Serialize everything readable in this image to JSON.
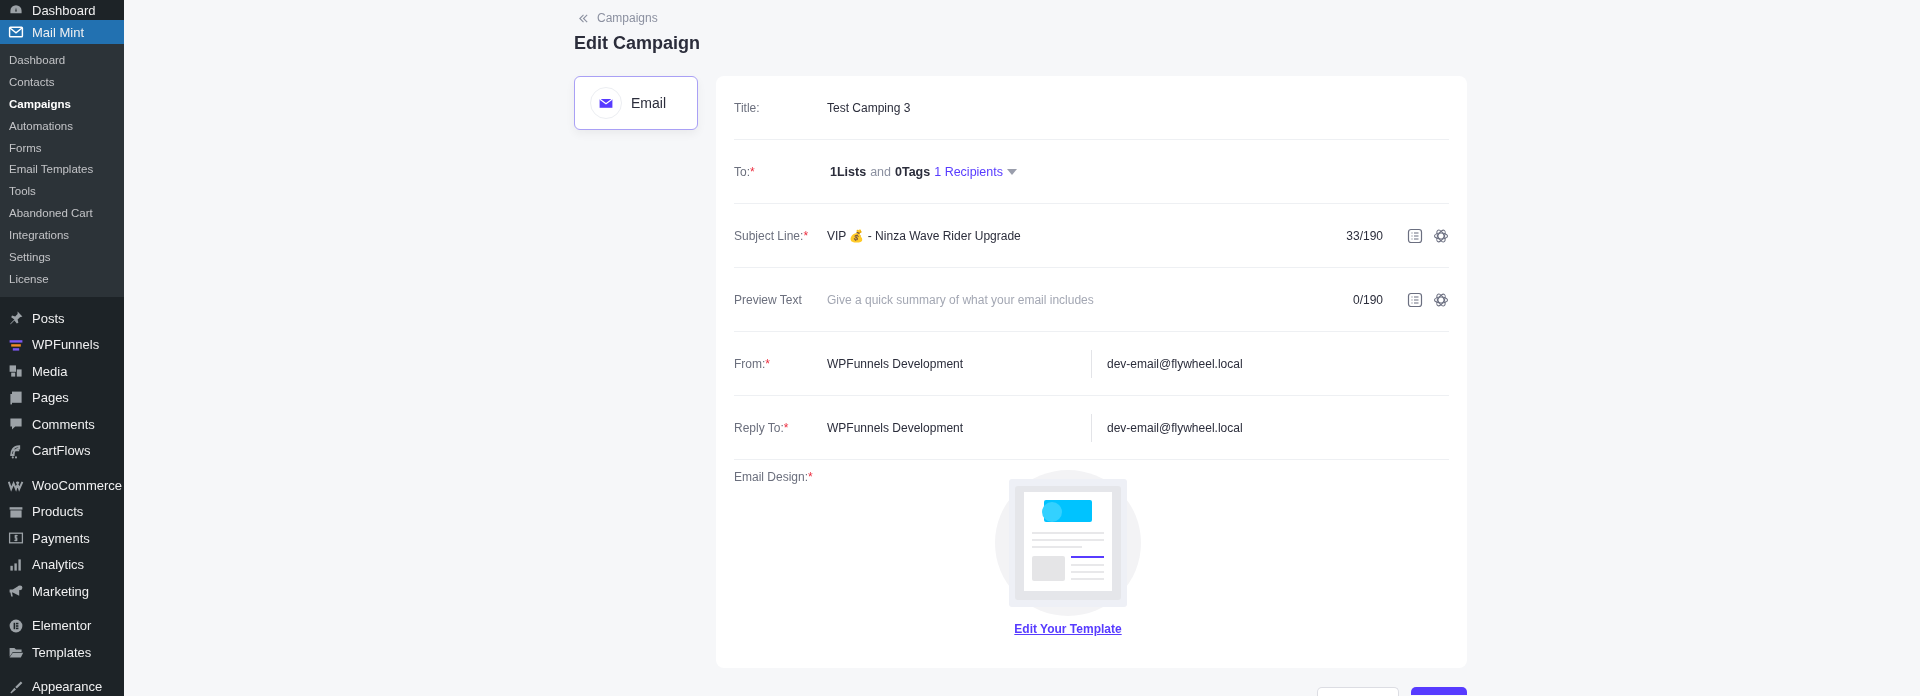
{
  "sidebar": {
    "top_items": [
      {
        "label": "Dashboard",
        "selected": false
      },
      {
        "label": "Mail Mint",
        "selected": true
      }
    ],
    "submenu": [
      {
        "label": "Dashboard",
        "selected": false
      },
      {
        "label": "Contacts",
        "selected": false
      },
      {
        "label": "Campaigns",
        "selected": true
      },
      {
        "label": "Automations",
        "selected": false
      },
      {
        "label": "Forms",
        "selected": false
      },
      {
        "label": "Email Templates",
        "selected": false
      },
      {
        "label": "Tools",
        "selected": false
      },
      {
        "label": "Abandoned Cart",
        "selected": false
      },
      {
        "label": "Integrations",
        "selected": false
      },
      {
        "label": "Settings",
        "selected": false
      },
      {
        "label": "License",
        "selected": false
      }
    ],
    "groups": [
      [
        {
          "label": "Posts"
        },
        {
          "label": "WPFunnels"
        },
        {
          "label": "Media"
        },
        {
          "label": "Pages"
        },
        {
          "label": "Comments"
        },
        {
          "label": "CartFlows"
        }
      ],
      [
        {
          "label": "WooCommerce"
        },
        {
          "label": "Products"
        },
        {
          "label": "Payments"
        },
        {
          "label": "Analytics"
        },
        {
          "label": "Marketing"
        }
      ],
      [
        {
          "label": "Elementor"
        },
        {
          "label": "Templates"
        }
      ],
      [
        {
          "label": "Appearance"
        }
      ]
    ]
  },
  "breadcrumb": "Campaigns",
  "title": "Edit Campaign",
  "tabs": [
    {
      "label": "Email",
      "selected": true
    }
  ],
  "form": {
    "rows": [
      {
        "kind": "text",
        "label": "Title:",
        "value": "Test Camping 3"
      },
      {
        "kind": "recipients",
        "label": "To:",
        "required_mark": "*",
        "lists": "1Lists",
        "joiner": "and",
        "tags": "0Tags",
        "recipients": "1 Recipients"
      },
      {
        "kind": "counter",
        "label": "Subject Line:",
        "required_mark": "*",
        "value": "VIP 💰 - Ninza Wave Rider Upgrade",
        "count": "33/190"
      },
      {
        "kind": "counter",
        "label": "Preview Text",
        "placeholder": "Give a quick summary of what your email includes",
        "count": "0/190"
      },
      {
        "kind": "pair",
        "label": "From:",
        "required_mark": "*",
        "name": "WPFunnels Development",
        "email": "dev-email@flywheel.local"
      },
      {
        "kind": "pair",
        "label": "Reply To:",
        "required_mark": "*",
        "name": "WPFunnels Development",
        "email": "dev-email@flywheel.local"
      },
      {
        "kind": "design",
        "label": "Email Design:",
        "required_mark": "*",
        "link": "Edit Your Template"
      }
    ]
  }
}
